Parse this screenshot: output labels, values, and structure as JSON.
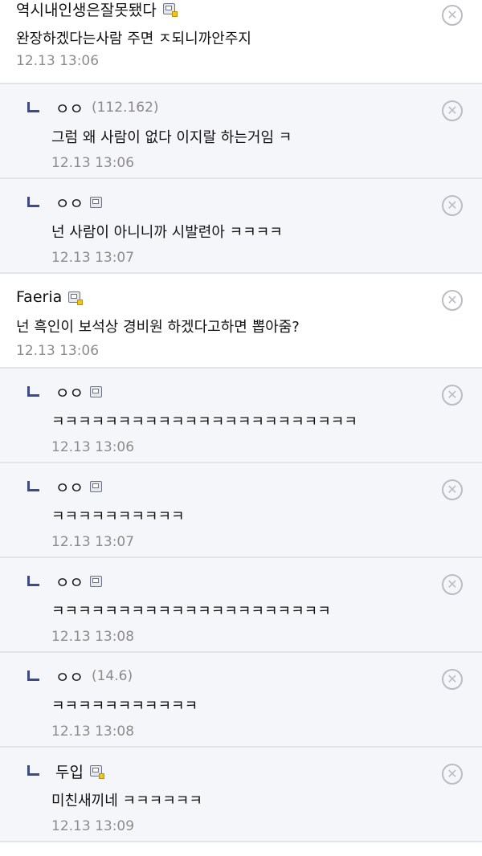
{
  "comments": [
    {
      "type": "comment",
      "nick": "역시내인생은잘못됐다",
      "ip": "",
      "icon": "fixed",
      "text": "완장하겠다는사람 주면 ㅈ되니까안주지",
      "time": "12.13 13:06"
    },
    {
      "type": "reply",
      "nick": "ㅇㅇ",
      "ip": "(112.162)",
      "icon": "",
      "text": "그럼 왜 사람이 없다 이지랄 하는거임 ㅋ",
      "time": "12.13 13:06"
    },
    {
      "type": "reply",
      "nick": "ㅇㅇ",
      "ip": "",
      "icon": "plain",
      "text": "넌 사람이 아니니까 시발련아 ㅋㅋㅋㅋ",
      "time": "12.13 13:07"
    },
    {
      "type": "comment",
      "nick": "Faeria",
      "ip": "",
      "icon": "fixed",
      "text": "넌 흑인이 보석상 경비원 하겠다고하면 뽑아줌?",
      "time": "12.13 13:06"
    },
    {
      "type": "reply",
      "nick": "ㅇㅇ",
      "ip": "",
      "icon": "plain",
      "text": "ㅋㅋㅋㅋㅋㅋㅋㅋㅋㅋㅋㅋㅋㅋㅋㅋㅋㅋㅋㅋㅋㅋㅋ",
      "time": "12.13 13:06"
    },
    {
      "type": "reply",
      "nick": "ㅇㅇ",
      "ip": "",
      "icon": "plain",
      "text": "ㅋㅋㅋㅋㅋㅋㅋㅋㅋㅋ",
      "time": "12.13 13:07"
    },
    {
      "type": "reply",
      "nick": "ㅇㅇ",
      "ip": "",
      "icon": "plain",
      "text": "ㅋㅋㅋㅋㅋㅋㅋㅋㅋㅋㅋㅋㅋㅋㅋㅋㅋㅋㅋㅋㅋ",
      "time": "12.13 13:08"
    },
    {
      "type": "reply",
      "nick": "ㅇㅇ",
      "ip": "(14.6)",
      "icon": "",
      "text": "ㅋㅋㅋㅋㅋㅋㅋㅋㅋㅋㅋ",
      "time": "12.13 13:08"
    },
    {
      "type": "reply",
      "nick": "두입",
      "ip": "",
      "icon": "fixed",
      "text": "미친새끼네 ㅋㅋㅋㅋㅋㅋ",
      "time": "12.13 13:09"
    }
  ],
  "delete_glyph": "✕"
}
